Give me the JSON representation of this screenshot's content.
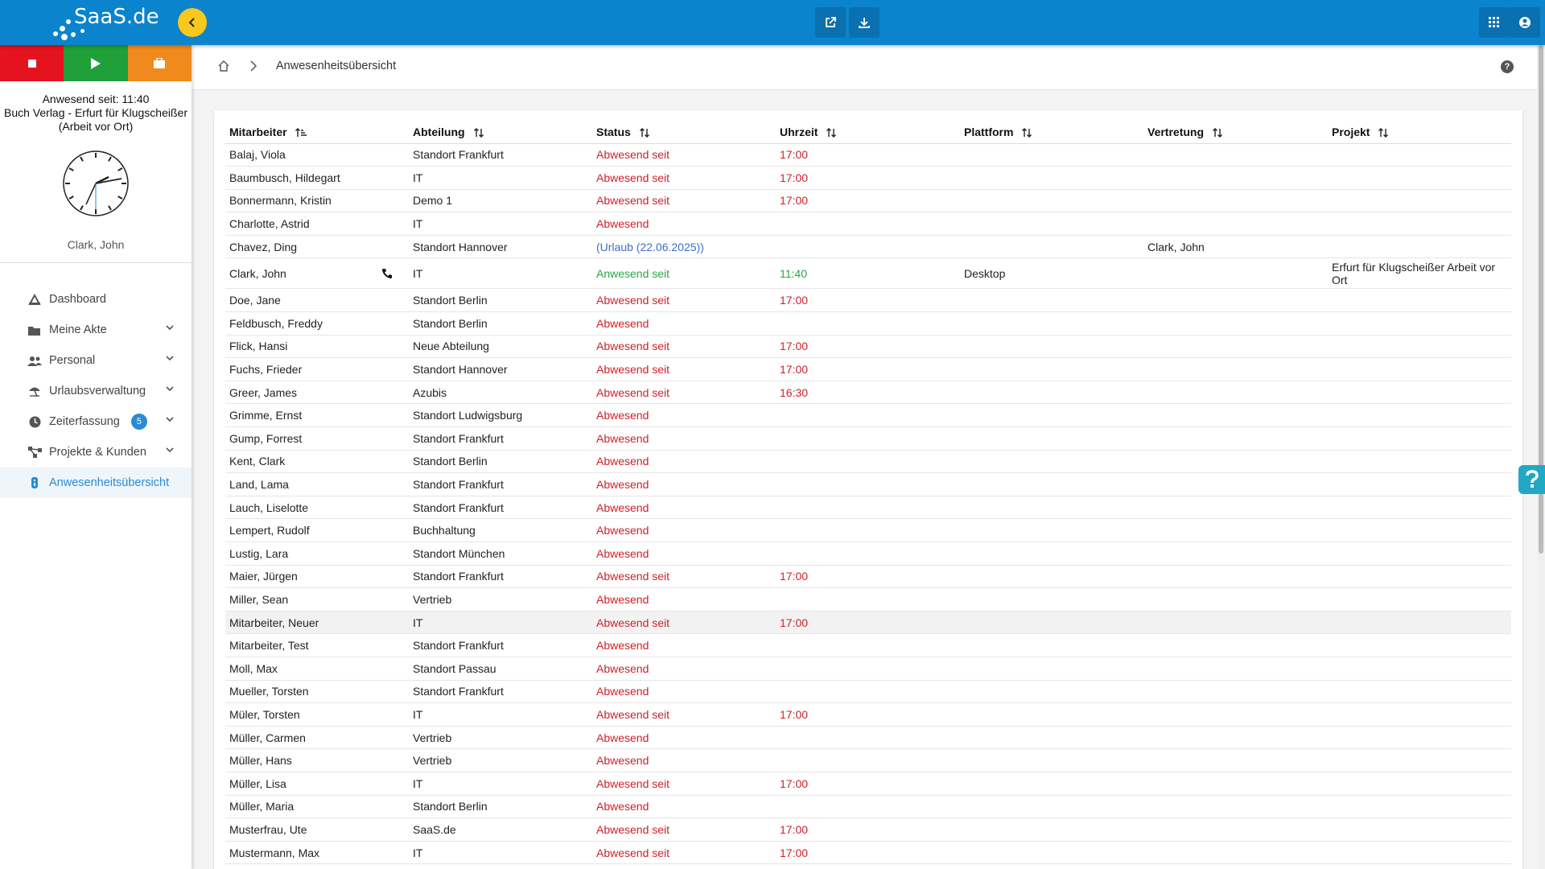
{
  "app": {
    "logo_text": "SaaS.de",
    "accent": "#0b84cd"
  },
  "toolbar": {
    "icons": [
      "external-link-icon",
      "download-icon",
      "apps-grid-icon",
      "account-icon"
    ]
  },
  "sidebar": {
    "presence_line1": "Anwesend seit: 11:40",
    "presence_line2": "Buch Verlag - Erfurt für Klugscheißer",
    "presence_line3": "(Arbeit vor Ort)",
    "user": "Clark, John",
    "nav": [
      {
        "label": "Dashboard",
        "icon": "dashboard-icon"
      },
      {
        "label": "Meine Akte",
        "icon": "folder-icon"
      },
      {
        "label": "Personal",
        "icon": "users-icon"
      },
      {
        "label": "Urlaubsverwaltung",
        "icon": "beach-umbrella-icon"
      },
      {
        "label": "Zeiterfassung",
        "icon": "clock-icon",
        "badge": "5"
      },
      {
        "label": "Projekte & Kunden",
        "icon": "network-icon"
      },
      {
        "label": "Anwesenheitsübersicht",
        "icon": "presence-icon",
        "active": true
      }
    ]
  },
  "breadcrumb": {
    "title": "Anwesenheitsübersicht",
    "help": "?"
  },
  "table": {
    "headers": [
      "Mitarbeiter",
      "Abteilung",
      "Status",
      "Uhrzeit",
      "Plattform",
      "Vertretung",
      "Projekt"
    ],
    "rows": [
      {
        "name": "Balaj, Viola",
        "dept": "Standort Frankfurt",
        "status": "Abwesend seit",
        "time": "17:00"
      },
      {
        "name": "Baumbusch, Hildegart",
        "dept": "IT",
        "status": "Abwesend seit",
        "time": "17:00"
      },
      {
        "name": "Bonnermann, Kristin",
        "dept": "Demo 1",
        "status": "Abwesend seit",
        "time": "17:00"
      },
      {
        "name": "Charlotte, Astrid",
        "dept": "IT",
        "status": "Abwesend"
      },
      {
        "name": "Chavez, Ding",
        "dept": "Standort Hannover",
        "status": "(Urlaub (22.06.2025))",
        "kind": "vacation",
        "vertretung": "Clark, John"
      },
      {
        "name": "Clark, John",
        "dept": "IT",
        "status": "Anwesend seit",
        "time": "11:40",
        "kind": "present",
        "platform": "Desktop",
        "project": "Erfurt für Klugscheißer Arbeit vor Ort",
        "phone": true
      },
      {
        "name": "Doe, Jane",
        "dept": "Standort Berlin",
        "status": "Abwesend seit",
        "time": "17:00"
      },
      {
        "name": "Feldbusch, Freddy",
        "dept": "Standort Berlin",
        "status": "Abwesend"
      },
      {
        "name": "Flick, Hansi",
        "dept": "Neue Abteilung",
        "status": "Abwesend seit",
        "time": "17:00"
      },
      {
        "name": "Fuchs, Frieder",
        "dept": "Standort Hannover",
        "status": "Abwesend seit",
        "time": "17:00"
      },
      {
        "name": "Greer, James",
        "dept": "Azubis",
        "status": "Abwesend seit",
        "time": "16:30"
      },
      {
        "name": "Grimme, Ernst",
        "dept": "Standort Ludwigsburg",
        "status": "Abwesend"
      },
      {
        "name": "Gump, Forrest",
        "dept": "Standort Frankfurt",
        "status": "Abwesend"
      },
      {
        "name": "Kent, Clark",
        "dept": "Standort Berlin",
        "status": "Abwesend"
      },
      {
        "name": "Land, Lama",
        "dept": "Standort Frankfurt",
        "status": "Abwesend"
      },
      {
        "name": "Lauch, Liselotte",
        "dept": "Standort Frankfurt",
        "status": "Abwesend"
      },
      {
        "name": "Lempert, Rudolf",
        "dept": "Buchhaltung",
        "status": "Abwesend"
      },
      {
        "name": "Lustig, Lara",
        "dept": "Standort München",
        "status": "Abwesend"
      },
      {
        "name": "Maier, Jürgen",
        "dept": "Standort Frankfurt",
        "status": "Abwesend seit",
        "time": "17:00"
      },
      {
        "name": "Miller, Sean",
        "dept": "Vertrieb",
        "status": "Abwesend"
      },
      {
        "name": "Mitarbeiter, Neuer",
        "dept": "IT",
        "status": "Abwesend seit",
        "time": "17:00",
        "highlight": true
      },
      {
        "name": "Mitarbeiter, Test",
        "dept": "Standort Frankfurt",
        "status": "Abwesend"
      },
      {
        "name": "Moll, Max",
        "dept": "Standort Passau",
        "status": "Abwesend"
      },
      {
        "name": "Mueller, Torsten",
        "dept": "Standort Frankfurt",
        "status": "Abwesend"
      },
      {
        "name": "Müler, Torsten",
        "dept": "IT",
        "status": "Abwesend seit",
        "time": "17:00"
      },
      {
        "name": "Müller, Carmen",
        "dept": "Vertrieb",
        "status": "Abwesend"
      },
      {
        "name": "Müller, Hans",
        "dept": "Vertrieb",
        "status": "Abwesend"
      },
      {
        "name": "Müller, Lisa",
        "dept": "IT",
        "status": "Abwesend seit",
        "time": "17:00"
      },
      {
        "name": "Müller, Maria",
        "dept": "Standort Berlin",
        "status": "Abwesend"
      },
      {
        "name": "Musterfrau, Ute",
        "dept": "SaaS.de",
        "status": "Abwesend seit",
        "time": "17:00"
      },
      {
        "name": "Mustermann, Max",
        "dept": "IT",
        "status": "Abwesend seit",
        "time": "17:00"
      }
    ]
  }
}
